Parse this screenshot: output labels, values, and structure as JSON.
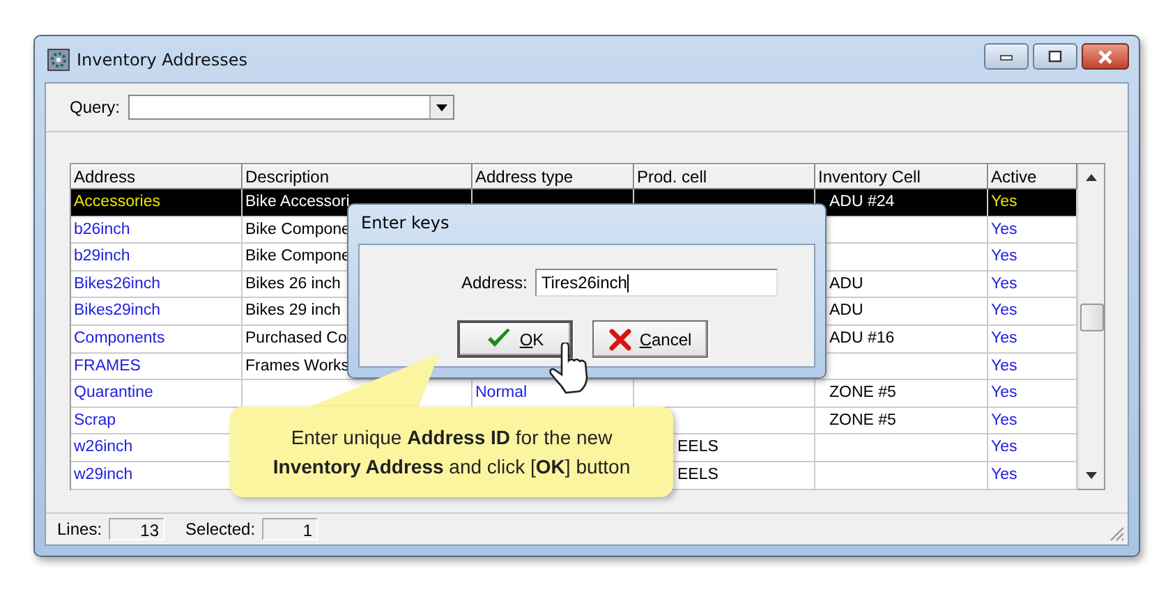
{
  "window": {
    "title": "Inventory Addresses"
  },
  "query": {
    "label": "Query:"
  },
  "table": {
    "columns": [
      "Address",
      "Description",
      "Address type",
      "Prod. cell",
      "Inventory Cell",
      "Active"
    ],
    "rows": [
      {
        "address": "Accessories",
        "description": "Bike Accessori",
        "inventory_cell": "ADU #24",
        "active": "Yes",
        "selected": true
      },
      {
        "address": "b26inch",
        "description": "Bike Compone",
        "active": "Yes",
        "selected": false
      },
      {
        "address": "b29inch",
        "description": "Bike Compone",
        "active": "Yes",
        "selected": false
      },
      {
        "address": "Bikes26inch",
        "description": "Bikes 26 inch",
        "inventory_cell": "ADU",
        "active": "Yes",
        "selected": false
      },
      {
        "address": "Bikes29inch",
        "description": "Bikes 29 inch",
        "inventory_cell": "ADU",
        "active": "Yes",
        "selected": false
      },
      {
        "address": "Components",
        "description": "Purchased Co",
        "inventory_cell": "ADU #16",
        "active": "Yes",
        "selected": false
      },
      {
        "address": "FRAMES",
        "description": "Frames Works",
        "active": "Yes",
        "selected": false
      },
      {
        "address": "Quarantine",
        "address_type": "Normal",
        "inventory_cell": "ZONE #5",
        "active": "Yes",
        "selected": false
      },
      {
        "address": "Scrap",
        "inventory_cell": "ZONE #5",
        "active": "Yes",
        "selected": false
      },
      {
        "address": "w26inch",
        "prod_cell": "EELS",
        "active": "Yes",
        "selected": false
      },
      {
        "address": "w29inch",
        "prod_cell": "EELS",
        "active": "Yes",
        "selected": false
      }
    ]
  },
  "status_bar": {
    "lines_label": "Lines:",
    "lines": "13",
    "selected_label": "Selected:",
    "selected": "1"
  },
  "dialog": {
    "title": "Enter keys",
    "field_label": "Address:",
    "value": "Tires26inch",
    "buttons": [
      {
        "kind": "ok",
        "label": "OK",
        "mnemonic": true
      },
      {
        "kind": "cancel",
        "label": "Cancel",
        "mnemonic": true
      }
    ]
  },
  "callout": {
    "text": "Enter unique **Address ID** for the new **Inventory Address** and click [**OK**] button"
  }
}
